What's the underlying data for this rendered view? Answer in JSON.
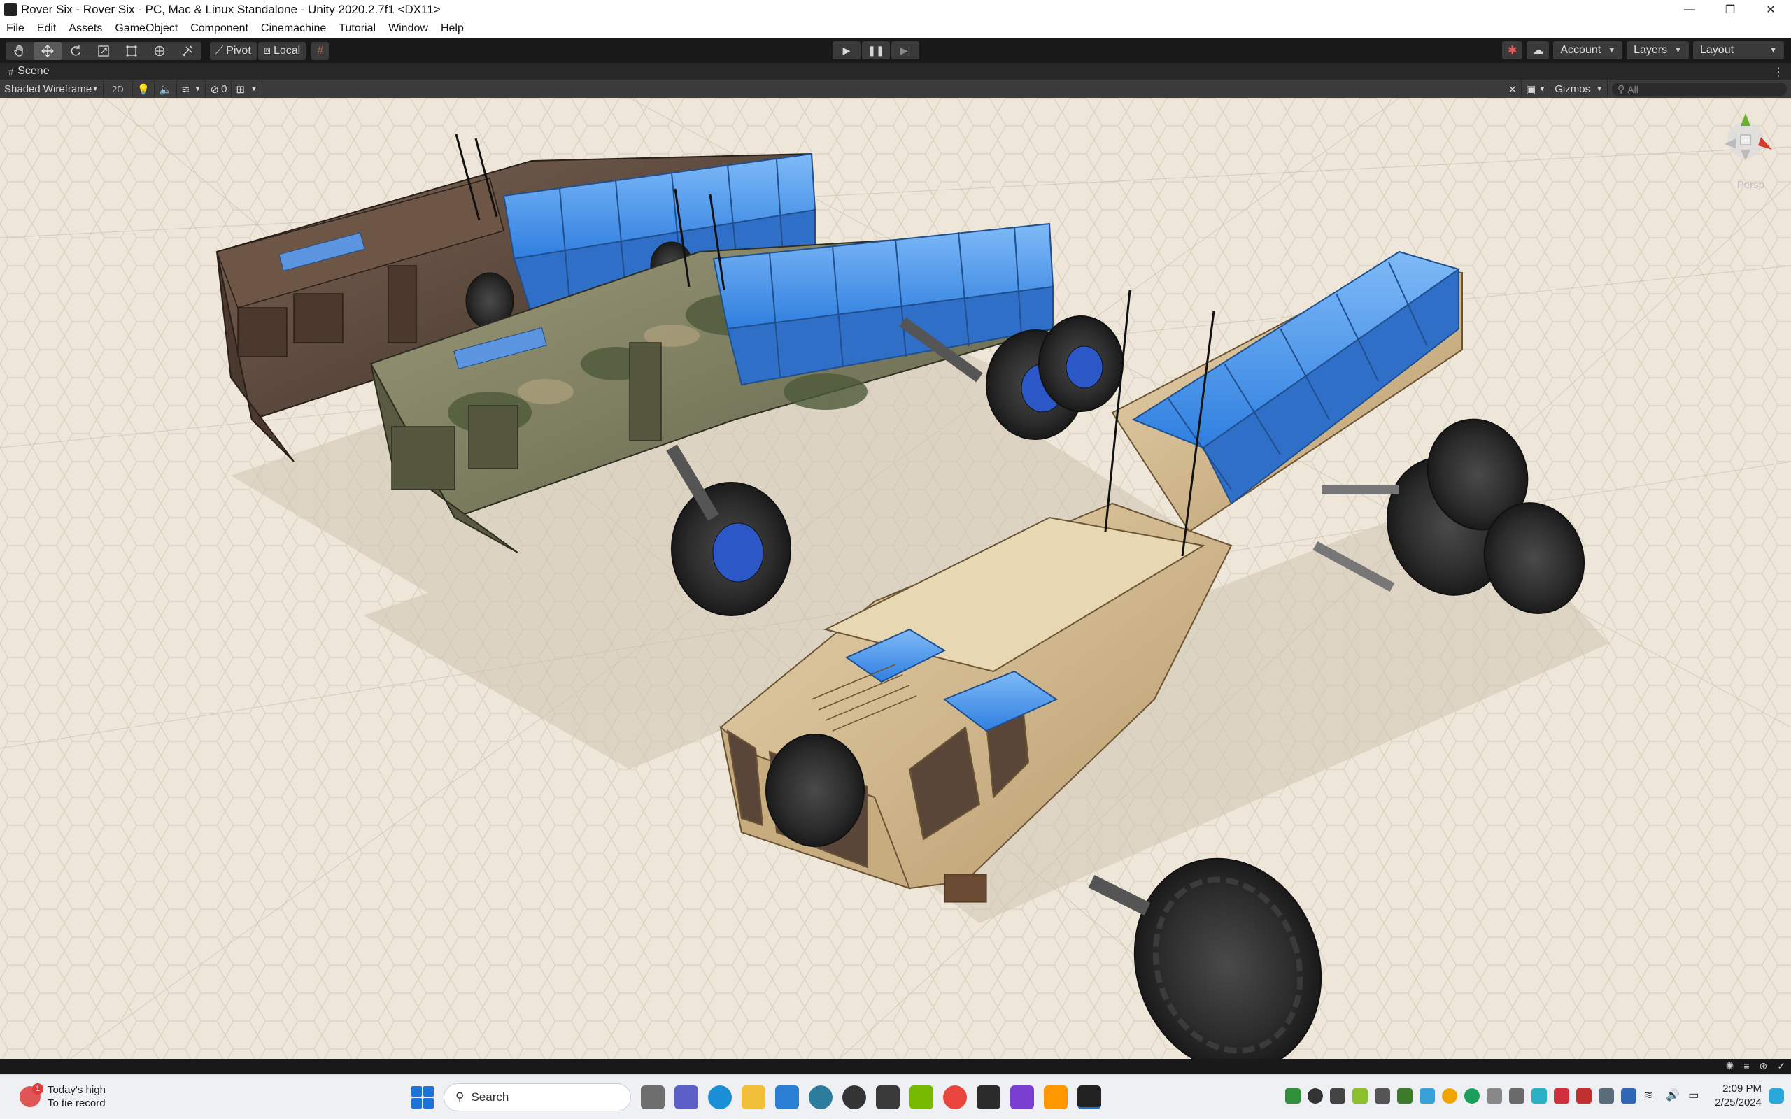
{
  "window": {
    "title": "Rover Six - Rover Six - PC, Mac & Linux Standalone - Unity 2020.2.7f1 <DX11>",
    "controls": [
      "—",
      "❐",
      "✕"
    ]
  },
  "menu": [
    "File",
    "Edit",
    "Assets",
    "GameObject",
    "Component",
    "Cinemachine",
    "Tutorial",
    "Window",
    "Help"
  ],
  "toolbar": {
    "tools": [
      "hand-icon",
      "move-icon",
      "rotate-icon",
      "scale-icon",
      "rect-icon",
      "transform-icon",
      "custom-tool-icon"
    ],
    "active_tool": "move-icon",
    "pivot_label": "Pivot",
    "local_label": "Local",
    "play_buttons": [
      "▶",
      "❚❚",
      "▶|"
    ],
    "account_label": "Account",
    "layers_label": "Layers",
    "layout_label": "Layout"
  },
  "scene_tab": {
    "label": "Scene"
  },
  "scene_toolbar": {
    "draw_mode": "Shaded Wireframe",
    "mode_2d": "2D",
    "hidden_count": "0",
    "gizmos_label": "Gizmos",
    "search_placeholder": "All"
  },
  "viewport": {
    "projection_label": "Persp",
    "background_color": "#ede6d9",
    "rovers": [
      {
        "livery": "dark-brown",
        "color": "#5a4538"
      },
      {
        "livery": "camouflage",
        "color": "#7d7a5a"
      },
      {
        "livery": "desert-tan",
        "color": "#d9c29a"
      }
    ],
    "cargo_color": "#3f8fe8"
  },
  "taskbar": {
    "weather_title": "Today's high",
    "weather_subtitle": "To tie record",
    "weather_badge": "1",
    "search_label": "Search",
    "time": "2:09 PM",
    "date": "2/25/2024"
  }
}
